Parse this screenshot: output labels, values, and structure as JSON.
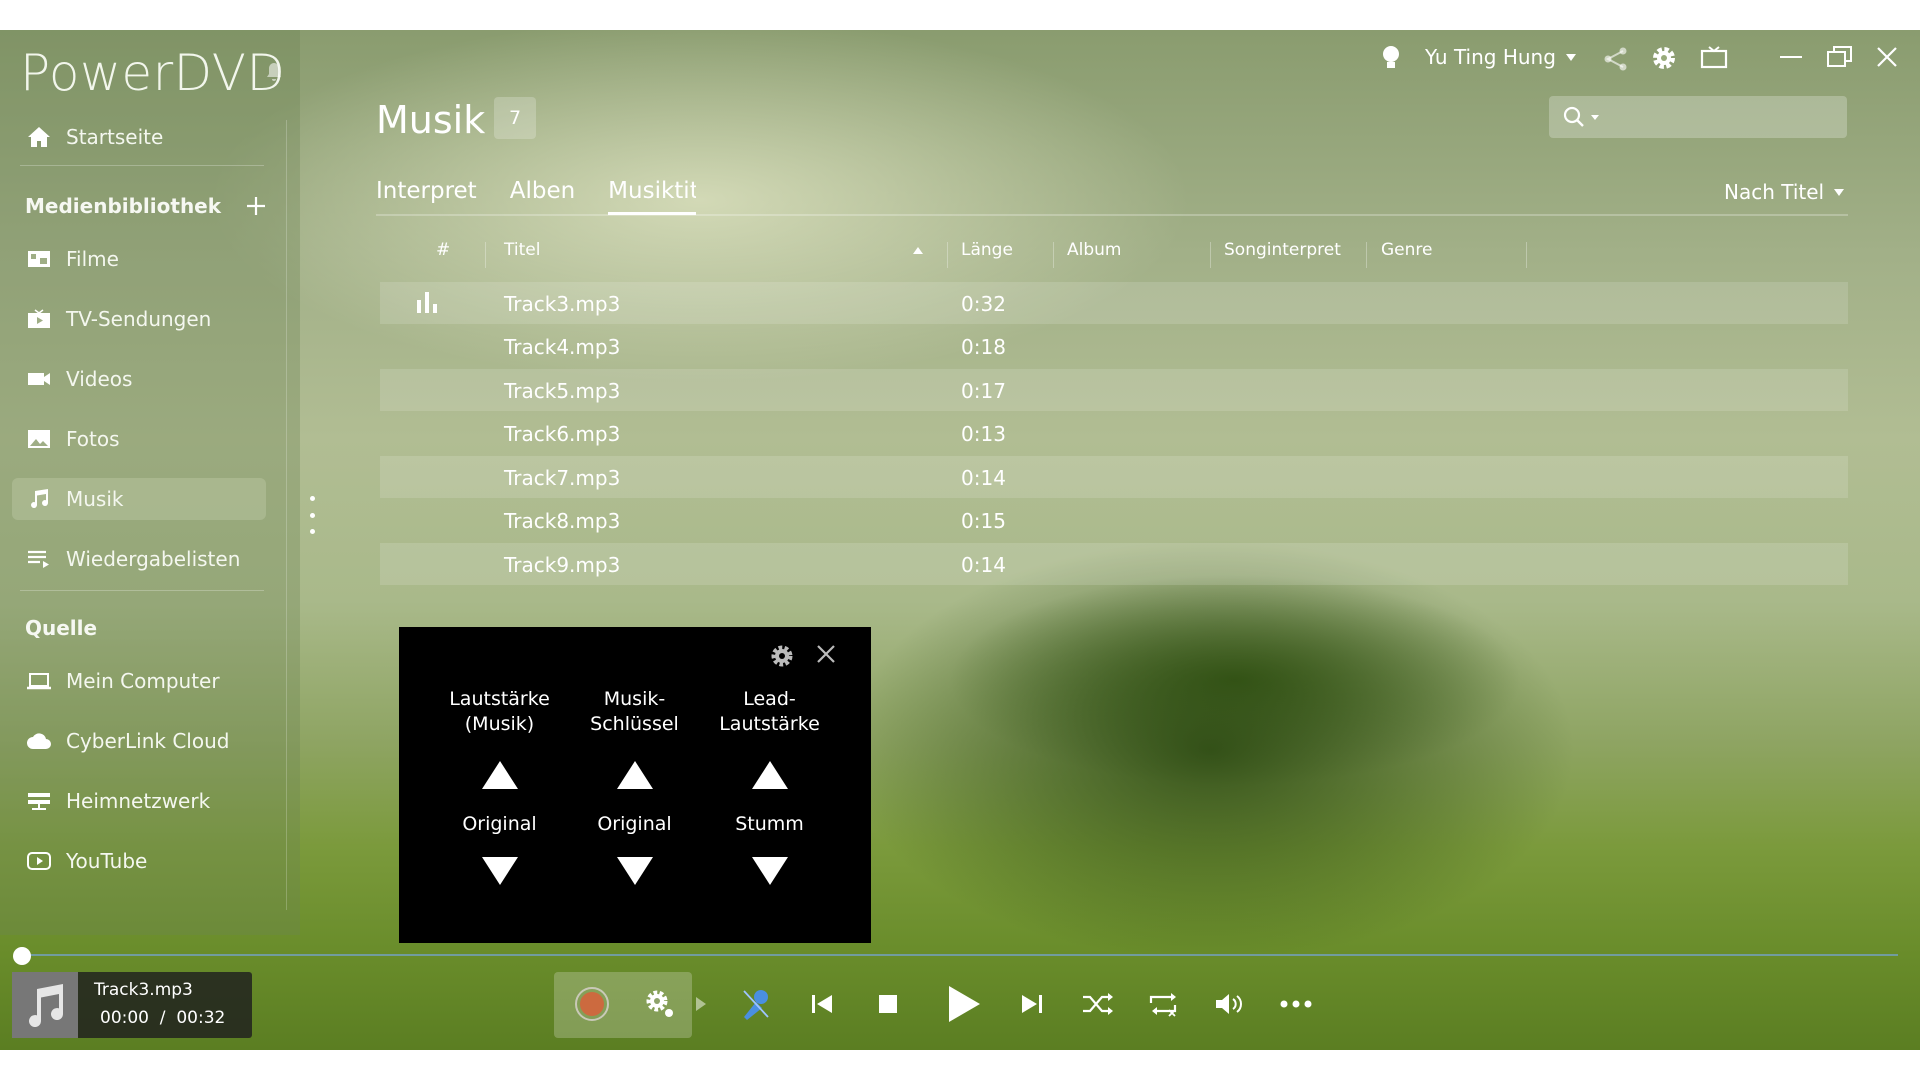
{
  "app": {
    "name": "PowerDVD"
  },
  "sidebar": {
    "home": "Startseite",
    "library_header": "Medienbibliothek",
    "library_items": [
      {
        "label": "Filme",
        "icon": "film-icon"
      },
      {
        "label": "TV-Sendungen",
        "icon": "tv-icon"
      },
      {
        "label": "Videos",
        "icon": "video-camera-icon"
      },
      {
        "label": "Fotos",
        "icon": "photo-icon"
      },
      {
        "label": "Musik",
        "icon": "music-note-icon",
        "active": true
      },
      {
        "label": "Wiedergabelisten",
        "icon": "playlist-icon"
      }
    ],
    "source_header": "Quelle",
    "source_items": [
      {
        "label": "Mein Computer",
        "icon": "laptop-icon"
      },
      {
        "label": "CyberLink Cloud",
        "icon": "cloud-icon"
      },
      {
        "label": "Heimnetzwerk",
        "icon": "network-icon"
      },
      {
        "label": "YouTube",
        "icon": "youtube-icon"
      }
    ]
  },
  "topbar": {
    "user": "Yu Ting Hung"
  },
  "header": {
    "title": "Musik",
    "count": "7",
    "sort_label": "Nach Titel"
  },
  "tabs": [
    {
      "label": "Interpret"
    },
    {
      "label": "Alben"
    },
    {
      "label": "Musiktitel",
      "active": true
    }
  ],
  "table": {
    "columns": [
      "#",
      "Titel",
      "Länge",
      "Album",
      "Songinterpret",
      "Genre"
    ],
    "rows": [
      {
        "title": "Track3.mp3",
        "length": "0:32",
        "playing": true
      },
      {
        "title": "Track4.mp3",
        "length": "0:18"
      },
      {
        "title": "Track5.mp3",
        "length": "0:17"
      },
      {
        "title": "Track6.mp3",
        "length": "0:13"
      },
      {
        "title": "Track7.mp3",
        "length": "0:14"
      },
      {
        "title": "Track8.mp3",
        "length": "0:15"
      },
      {
        "title": "Track9.mp3",
        "length": "0:14"
      }
    ]
  },
  "karaoke_popup": {
    "columns": [
      {
        "label": "Lautstärke\n(Musik)",
        "value": "Original"
      },
      {
        "label": "Musik-\nSchlüssel",
        "value": "Original"
      },
      {
        "label": "Lead-\nLautstärke",
        "value": "Stumm"
      }
    ]
  },
  "player": {
    "track": "Track3.mp3",
    "position": "00:00",
    "duration": "00:32",
    "progress": 0.0
  }
}
